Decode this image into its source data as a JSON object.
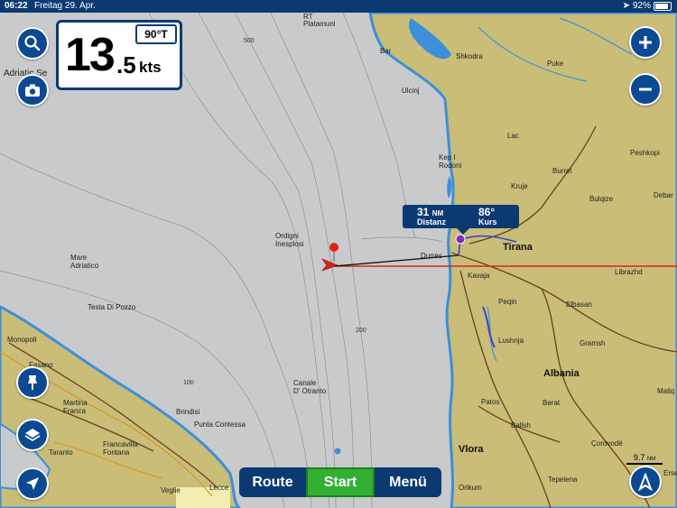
{
  "status_bar": {
    "time": "06:22",
    "date": "Freitag 29. Apr.",
    "battery": "92%"
  },
  "speed": {
    "integer": "13",
    "decimal": ".5",
    "unit": "kts",
    "heading": "90°T"
  },
  "route_info": {
    "distance_value": "31",
    "distance_unit": "NM",
    "distance_label": "Distanz",
    "course_value": "86°",
    "course_label": "Kurs"
  },
  "bottom_bar": {
    "route_label": "Route",
    "start_label": "Start",
    "menu_label": "Menü"
  },
  "scale": {
    "value": "9.7",
    "unit": "NM"
  },
  "map_labels": {
    "adriatic_sea": "Adriatic Se",
    "platamuni": "Platamuni",
    "rt": "RT",
    "bar": "Bar",
    "shkodra": "Shkodra",
    "puke": "Puke",
    "ulcinj": "Ulcinj",
    "lac": "Lac",
    "peshkopi": "Peshkopi",
    "burrel": "Burrel",
    "kep_i_rodoni": "Kep I\nRodoni",
    "kruje": "Kruje",
    "bulqize": "Bulqize",
    "debar": "Debar",
    "tirana": "Tirana",
    "durres": "Durres",
    "librazhd": "Librazhd",
    "kavaja": "Kavaja",
    "peqin": "Peqin",
    "elbasan": "Elbasan",
    "ordigni": "Ordigni\nInesplosi",
    "mare_adriatico": "Mare\nAdriatico",
    "testa_di_pozzo": "Testa Di Pozzo",
    "lushnja": "Lushnja",
    "gramsh": "Gramsh",
    "albania": "Albania",
    "monopoli": "Monopoli",
    "fasano": "Fasano",
    "canale": "Canale\nD' Otranto",
    "martina": "Martina\nFranca",
    "brindisi": "Brindisi",
    "punta_contessa": "Punta Contessa",
    "patos": "Patos",
    "berat": "Berat",
    "maliq": "Maliq",
    "taranto": "Taranto",
    "francavilla": "Francavilla\nFontana",
    "ballsh": "Ballsh",
    "corovode": "Çorovodë",
    "vlora": "Vlora",
    "orikum": "Orikum",
    "veglie": "Veglie",
    "lecce": "Lecce",
    "tepelena": "Tepelena",
    "ersek": "Erse",
    "depth_500": "500",
    "depth_200": "200",
    "depth_100": "100"
  },
  "colors": {
    "sea": "#c9cacb",
    "land": "#c9bd78",
    "shore": "#3d8fd8",
    "ui_blue": "#0b3a73",
    "start_green": "#33b033",
    "course_line": "#d8241c"
  }
}
